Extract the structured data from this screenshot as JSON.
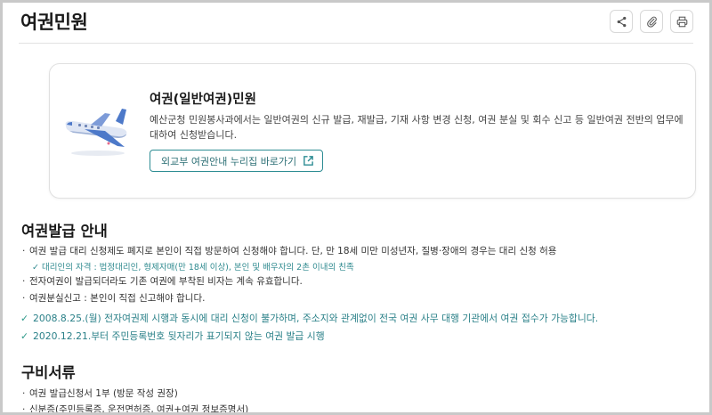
{
  "page": {
    "title": "여권민원"
  },
  "toolbar": {
    "share_icon": "share-icon",
    "attach_icon": "paperclip-icon",
    "print_icon": "printer-icon"
  },
  "card": {
    "title": "여권(일반여권)민원",
    "description": "예산군청 민원봉사과에서는 일반여권의 신규 발급, 재발급, 기재 사항 변경 신청, 여권 분실 및 회수 신고 등 일반여권 전반의 업무에 대하여 신청받습니다.",
    "link_label": "외교부 여권안내 누리집 바로가기",
    "link_icon": "external-link-icon"
  },
  "issuance": {
    "title": "여권발급 안내",
    "bullets": [
      "여권 발급 대리 신청제도 폐지로 본인이 직접 방문하여 신청해야 합니다. 단, 만 18세 미만 미성년자, 질병·장애의 경우는 대리 신청 허용",
      "전자여권이 발급되더라도 기존 여권에 부착된 비자는 계속 유효합니다.",
      "여권분실신고 : 본인이 직접 신고해야 합니다."
    ],
    "sub_note": "대리인의 자격 : 법정대리인, 형제자매(만 18세 이상), 본인 및 배우자의 2촌 이내의 친족",
    "checks": [
      "2008.8.25.(월) 전자여권제 시행과 동시에 대리 신청이 불가하며, 주소지와 관계없이 전국 여권 사무 대행 기관에서 여권 접수가 가능합니다.",
      "2020.12.21.부터 주민등록번호 뒷자리가 표기되지 않는 여권 발급 시행"
    ]
  },
  "documents": {
    "title": "구비서류",
    "bullets": [
      "여권 발급신청서 1부 (방문 작성 권장)",
      "신분증(주민등록증, 운전면허증, 여권+여권 정보증명서)"
    ]
  },
  "colors": {
    "accent": "#2c8c93",
    "check": "#2a8088"
  }
}
